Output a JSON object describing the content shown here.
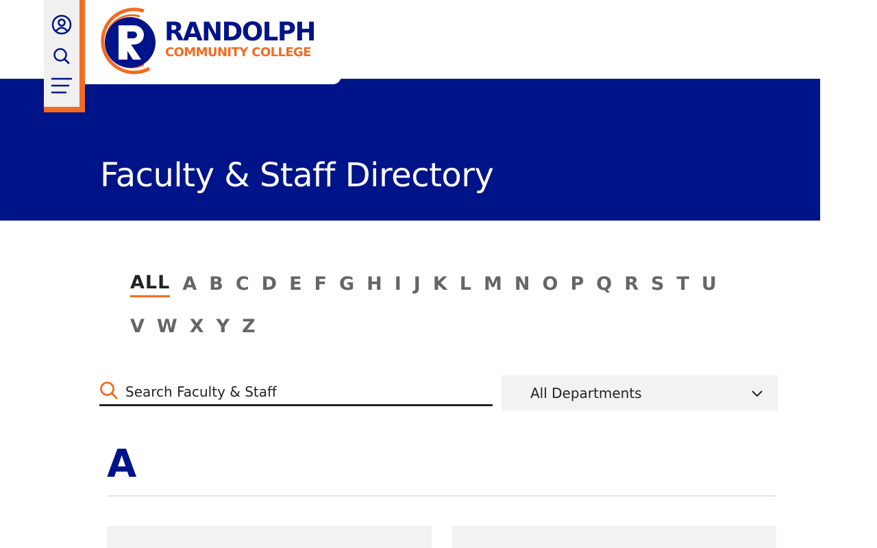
{
  "brand": {
    "name": "RANDOLPH",
    "subtitle": "COMMUNITY COLLEGE",
    "primary_color": "#001489",
    "accent_color": "#f26b21"
  },
  "utility_icons": [
    "user-account-icon",
    "search-icon",
    "menu-icon"
  ],
  "hero": {
    "title": "Faculty & Staff Directory"
  },
  "alphabet": {
    "active": "ALL",
    "letters": [
      "ALL",
      "A",
      "B",
      "C",
      "D",
      "E",
      "F",
      "G",
      "H",
      "I",
      "J",
      "K",
      "L",
      "M",
      "N",
      "O",
      "P",
      "Q",
      "R",
      "S",
      "T",
      "U",
      "V",
      "W",
      "X",
      "Y",
      "Z"
    ]
  },
  "search": {
    "placeholder": "Search Faculty & Staff",
    "value": ""
  },
  "department_filter": {
    "selected": "All Departments"
  },
  "results": {
    "section_letter": "A"
  }
}
